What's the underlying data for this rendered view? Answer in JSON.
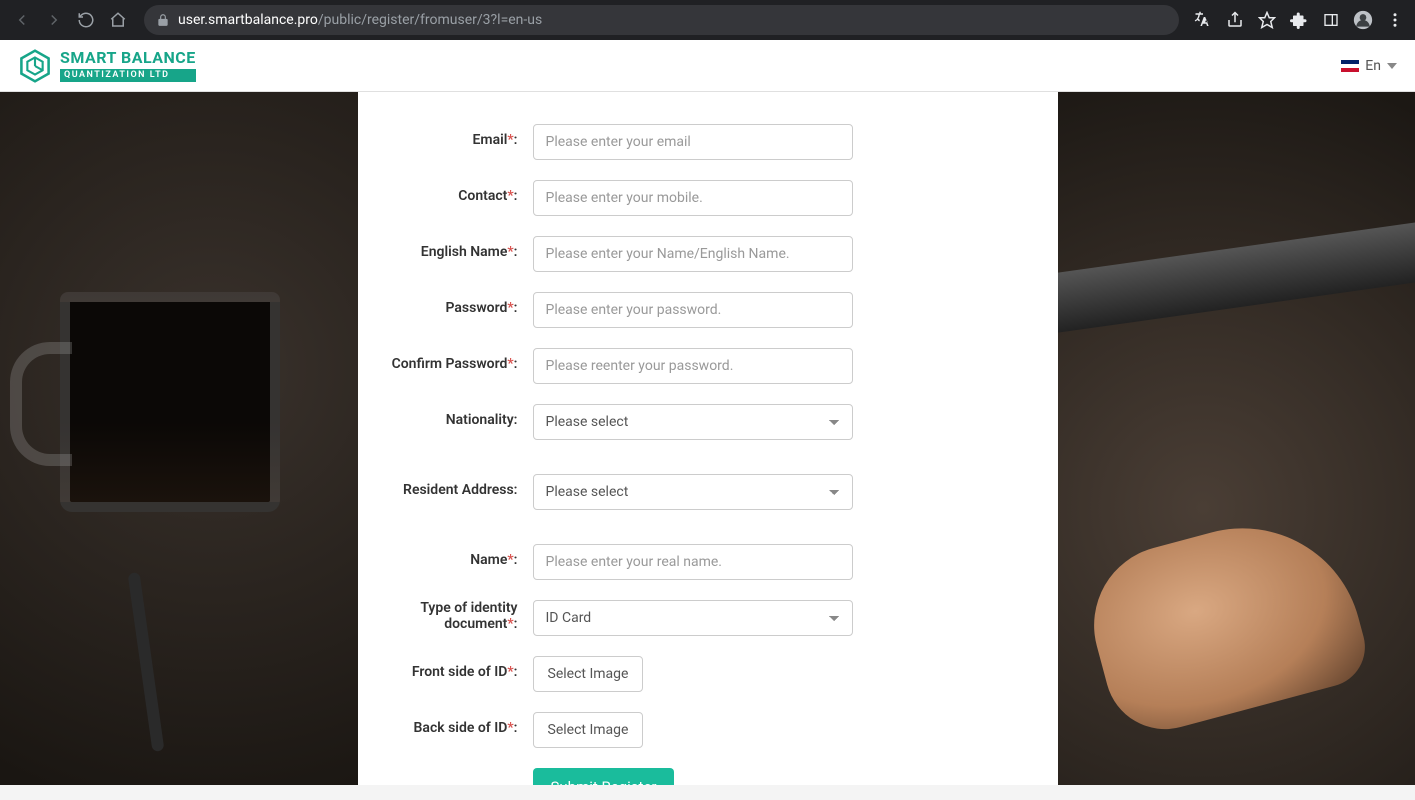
{
  "browser": {
    "url_domain": "user.smartbalance.pro",
    "url_path": "/public/register/fromuser/3?l=en-us"
  },
  "header": {
    "logo_line1": "SMART BALANCE",
    "logo_line2": "QUANTIZATION  LTD",
    "lang_label": "En"
  },
  "form": {
    "email_label": "Email",
    "email_placeholder": "Please enter your email",
    "contact_label": "Contact",
    "contact_placeholder": "Please enter your mobile.",
    "englishname_label": "English Name",
    "englishname_placeholder": "Please enter your Name/English Name.",
    "password_label": "Password",
    "password_placeholder": "Please enter your password.",
    "confirm_label": "Confirm Password",
    "confirm_placeholder": "Please reenter your password.",
    "nationality_label": "Nationality:",
    "nationality_selected": "Please select",
    "resident_label": "Resident Address:",
    "resident_selected": "Please select",
    "name_label": "Name",
    "name_placeholder": "Please enter your real name.",
    "doctype_label": "Type of identity document",
    "doctype_selected": "ID Card",
    "front_label": "Front side of ID",
    "back_label": "Back side of ID",
    "select_image": "Select Image",
    "submit": "Submit Register",
    "colon": ":"
  }
}
